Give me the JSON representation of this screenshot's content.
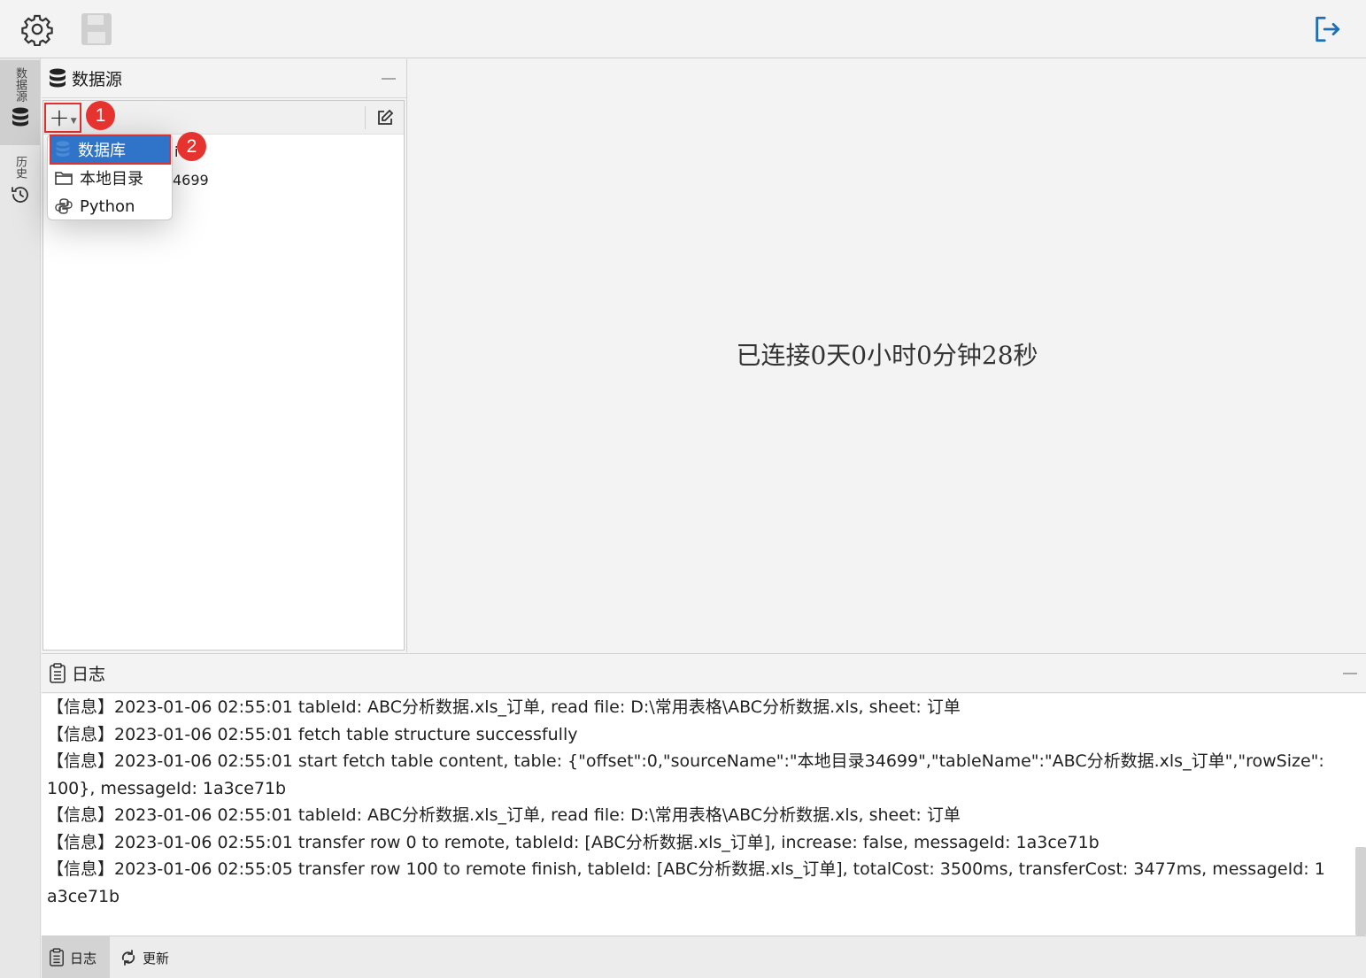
{
  "toolbar": {
    "settings_icon": "gear-icon",
    "save_icon": "save-icon",
    "exit_icon": "logout-icon"
  },
  "sidebar": {
    "tabs": [
      {
        "label": "数据源",
        "icon": "database-icon",
        "active": true
      },
      {
        "label": "历史",
        "icon": "history-icon",
        "active": false
      }
    ]
  },
  "datasource_panel": {
    "title": "数据源",
    "add_button": "+",
    "tree_partial": {
      "row1": "i",
      "row2": "4699"
    }
  },
  "add_menu": {
    "items": [
      {
        "label": "数据库",
        "icon": "database-icon",
        "selected": true
      },
      {
        "label": "本地目录",
        "icon": "folder-icon",
        "selected": false
      },
      {
        "label": "Python",
        "icon": "python-icon",
        "selected": false
      }
    ]
  },
  "annotations": {
    "step1": "1",
    "step2": "2",
    "color": "#e6332f"
  },
  "main": {
    "status": "已连接0天0小时0分钟28秒"
  },
  "log_panel": {
    "title": "日志",
    "lines": [
      "【信息】2023-01-06 02:55:01 tableId: ABC分析数据.xls_订单, read file: D:\\常用表格\\ABC分析数据.xls, sheet: 订单",
      "【信息】2023-01-06 02:55:01 fetch table structure successfully",
      "【信息】2023-01-06 02:55:01 start fetch table content, table: {\"offset\":0,\"sourceName\":\"本地目录34699\",\"tableName\":\"ABC分析数据.xls_订单\",\"rowSize\":100}, messageId: 1a3ce71b",
      "【信息】2023-01-06 02:55:01 tableId: ABC分析数据.xls_订单, read file: D:\\常用表格\\ABC分析数据.xls, sheet: 订单",
      "【信息】2023-01-06 02:55:01 transfer row 0 to remote, tableId: [ABC分析数据.xls_订单], increase: false, messageId: 1a3ce71b",
      "【信息】2023-01-06 02:55:05 transfer row 100 to remote finish, tableId: [ABC分析数据.xls_订单], totalCost: 3500ms, transferCost: 3477ms, messageId: 1a3ce71b"
    ]
  },
  "bottom_tabs": [
    {
      "label": "日志",
      "icon": "clipboard-icon",
      "active": true
    },
    {
      "label": "更新",
      "icon": "update-icon",
      "active": false
    }
  ],
  "colors": {
    "accent": "#2f74c9",
    "highlight_border": "#e0312e"
  }
}
